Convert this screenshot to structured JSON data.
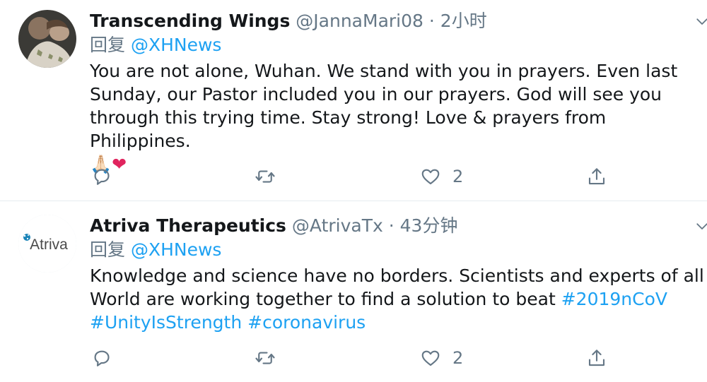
{
  "tweets": [
    {
      "display_name": "Transcending Wings",
      "handle": "@JannaMari08",
      "separator": "·",
      "time": "2小时",
      "reply_prefix": "回复",
      "reply_to": "@XHNews",
      "text": "You are not alone, Wuhan. We stand with you in prayers. Even last Sunday, our Pastor included you in our prayers. God will see you through this trying time. Stay strong! Love & prayers from Philippines.",
      "emoji": [
        "🙏🏻",
        "❤"
      ],
      "likes": "2"
    },
    {
      "display_name": "Atriva Therapeutics",
      "handle": "@AtrivaTx",
      "separator": "·",
      "time": "43分钟",
      "reply_prefix": "回复",
      "reply_to": "@XHNews",
      "text": "Knowledge and science have no borders. Scientists and experts of all World are working together to find a solution to beat",
      "hashtags": [
        "#2019nCoV",
        "#UnityIsStrength",
        "#coronavirus"
      ],
      "avatar_logo_text": "Atriva",
      "likes": "2"
    }
  ],
  "icons": {
    "reply": "reply-icon",
    "retweet": "retweet-icon",
    "like": "heart-icon",
    "share": "share-icon",
    "more": "chevron-down-icon"
  },
  "colors": {
    "accent": "#1da1f2",
    "secondary_text": "#657786",
    "primary_text": "#14171a",
    "heart": "#e0245e",
    "divider": "#e6ecf0"
  }
}
